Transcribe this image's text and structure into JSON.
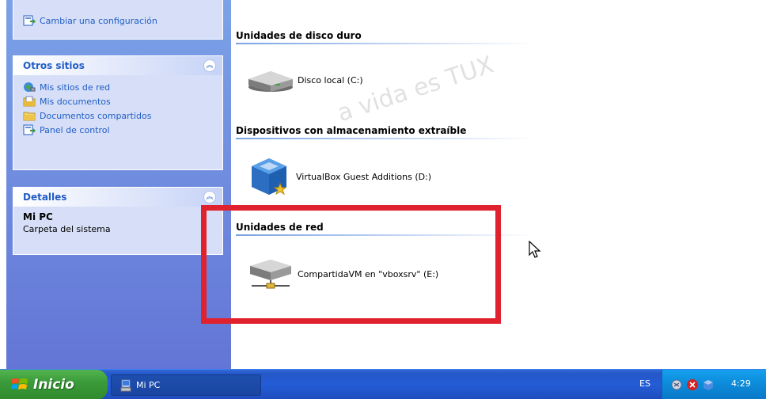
{
  "sidebar": {
    "top_task": {
      "label": "Cambiar una configuración",
      "icon": "control-panel-icon"
    },
    "otros_sitios": {
      "title": "Otros sitios",
      "items": [
        {
          "label": "Mis sitios de red",
          "icon": "network-places-icon"
        },
        {
          "label": "Mis documentos",
          "icon": "my-documents-icon"
        },
        {
          "label": "Documentos compartidos",
          "icon": "folder-icon"
        },
        {
          "label": "Panel de control",
          "icon": "control-panel-icon"
        }
      ]
    },
    "detalles": {
      "title": "Detalles",
      "name": "Mi PC",
      "description": "Carpeta del sistema"
    }
  },
  "main": {
    "groups": [
      {
        "title": "Unidades de disco duro",
        "items": [
          {
            "label": "Disco local (C:)",
            "icon": "hard-disk-icon"
          }
        ]
      },
      {
        "title": "Dispositivos con almacenamiento extraíble",
        "items": [
          {
            "label": "VirtualBox Guest Additions (D:)",
            "icon": "virtualbox-cd-icon"
          }
        ]
      },
      {
        "title": "Unidades de red",
        "items": [
          {
            "label": "CompartidaVM en \"vboxsrv\" (E:)",
            "icon": "network-drive-icon"
          }
        ]
      }
    ],
    "watermark": "a vida es TUX"
  },
  "taskbar": {
    "start_label": "Inicio",
    "window_label": "Mi PC",
    "language": "ES",
    "clock": "4:29"
  },
  "colors": {
    "sidebar_gradient_top": "#7ba2e7",
    "sidebar_gradient_bottom": "#6375d6",
    "taskbar_blue": "#245dd7",
    "start_green": "#3b9b3a",
    "highlight_red": "#e0222f",
    "link_blue": "#215dc6"
  }
}
